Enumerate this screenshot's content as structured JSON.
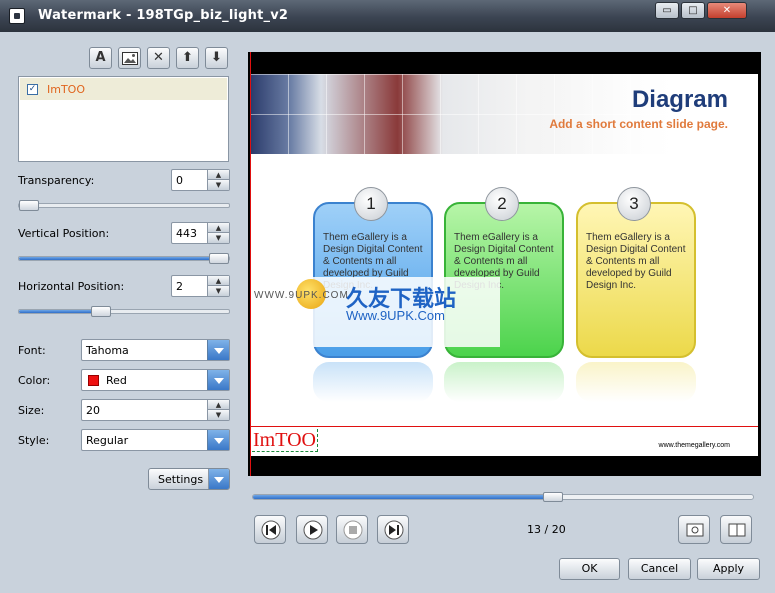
{
  "window": {
    "title": "Watermark - 198TGp_biz_light_v2",
    "controls": {
      "minimize": "▭",
      "maximize": "□",
      "close": "✕"
    }
  },
  "toolbar": {
    "add_text_glyph": "A",
    "delete_glyph": "✕",
    "move_up_glyph": "⬆",
    "move_down_glyph": "⬇"
  },
  "watermark_list": {
    "items": [
      {
        "label": "ImTOO",
        "checked": true,
        "check_glyph": "✓"
      }
    ]
  },
  "settings": {
    "transparency": {
      "label": "Transparency:",
      "value": "0",
      "fraction": 0.0
    },
    "vertical_position": {
      "label": "Vertical Position:",
      "value": "443",
      "fraction": 0.96
    },
    "horizontal_position": {
      "label": "Horizontal Position:",
      "value": "2",
      "fraction": 0.39
    },
    "font": {
      "label": "Font:",
      "value": "Tahoma"
    },
    "color": {
      "label": "Color:",
      "value": "Red",
      "swatch": "#ee1111"
    },
    "size": {
      "label": "Size:",
      "value": "20"
    },
    "style": {
      "label": "Style:",
      "value": "Regular"
    },
    "settings_button": "Settings",
    "spin_up": "▲",
    "spin_down": "▼"
  },
  "slide": {
    "title": "Diagram",
    "subtitle": "Add a short content slide page.",
    "cards": [
      {
        "number": "1",
        "text": "Them eGallery is a Design Digital Content & Contents m all developed by Guild Design Inc."
      },
      {
        "number": "2",
        "text": "Them eGallery is a Design Digital Content & Contents m all developed by Guild Design Inc."
      },
      {
        "number": "3",
        "text": "Them eGallery is a Design Digital Content & Contents m all developed by Guild Design Inc."
      }
    ],
    "footer_url": "www.themegallery.com",
    "watermark_text": "ImTOO"
  },
  "site_watermark": {
    "chinese": "久友下载站",
    "url": "Www.9UPK.Com",
    "url_left": "WWW.9UPK.COM"
  },
  "playback": {
    "progress_fraction": 0.6,
    "counter": "13 / 20"
  },
  "buttons": {
    "ok": "OK",
    "cancel": "Cancel",
    "apply": "Apply"
  }
}
